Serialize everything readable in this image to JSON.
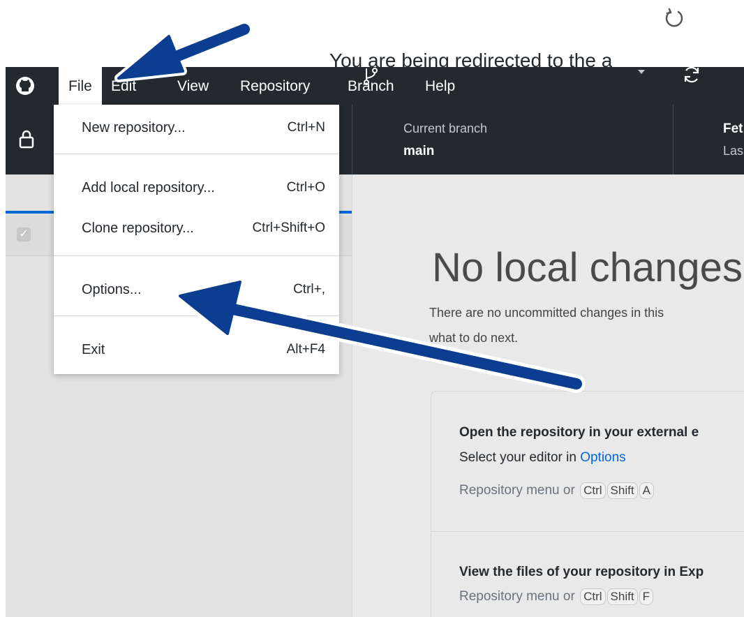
{
  "redirect_text": "You are being redirected to the a",
  "menubar": {
    "items": [
      "File",
      "Edit",
      "View",
      "Repository",
      "Branch",
      "Help"
    ]
  },
  "toolbar": {
    "branch_label": "Current branch",
    "branch_value": "main",
    "fetch_label": "Fet",
    "fetch_sub": "Las"
  },
  "file_menu": [
    {
      "label": "New repository...",
      "shortcut": "Ctrl+N"
    },
    {
      "label": "Add local repository...",
      "shortcut": "Ctrl+O"
    },
    {
      "label": "Clone repository...",
      "shortcut": "Ctrl+Shift+O"
    },
    {
      "label": "Options...",
      "shortcut": "Ctrl+,"
    },
    {
      "label": "Exit",
      "shortcut": "Alt+F4"
    }
  ],
  "main": {
    "title": "No local changes",
    "description_1": "There are no uncommitted changes in this",
    "description_2": "what to do next.",
    "card1": {
      "title": "Open the repository in your external e",
      "text_prefix": "Select your editor in ",
      "link": "Options",
      "hint": "Repository menu or",
      "keys": [
        "Ctrl",
        "Shift",
        "A"
      ]
    },
    "card2": {
      "title": "View the files of your repository in Exp",
      "hint": "Repository menu or",
      "keys": [
        "Ctrl",
        "Shift",
        "F"
      ]
    }
  },
  "colors": {
    "titlebar": "#24292e",
    "arrow": "#0b3d91",
    "link": "#0366d6"
  }
}
